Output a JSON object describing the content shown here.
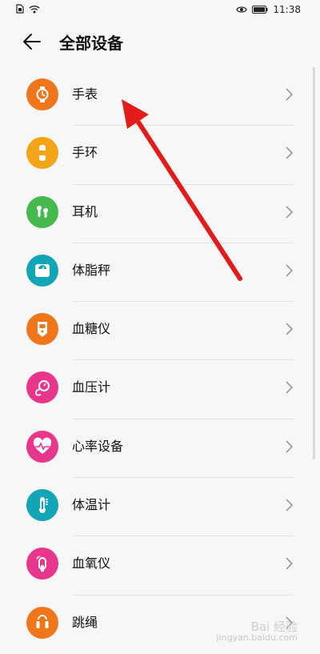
{
  "status_bar": {
    "time": "11:38",
    "left_icons": [
      "sim-icon",
      "wifi-icon"
    ],
    "right_icons": [
      "eye-icon",
      "battery-icon"
    ]
  },
  "header": {
    "title": "全部设备",
    "back_icon": "back-arrow-icon"
  },
  "devices": [
    {
      "label": "手表",
      "icon": "watch-icon",
      "color": "#f0761c"
    },
    {
      "label": "手环",
      "icon": "band-icon",
      "color": "#f5a416"
    },
    {
      "label": "耳机",
      "icon": "earphone-icon",
      "color": "#45b94e"
    },
    {
      "label": "体脂秤",
      "icon": "scale-icon",
      "color": "#12a5b5"
    },
    {
      "label": "血糖仪",
      "icon": "glucose-meter-icon",
      "color": "#f0761c"
    },
    {
      "label": "血压计",
      "icon": "blood-pressure-icon",
      "color": "#e8368c"
    },
    {
      "label": "心率设备",
      "icon": "heart-rate-icon",
      "color": "#e8368c"
    },
    {
      "label": "体温计",
      "icon": "thermometer-icon",
      "color": "#12a5b5"
    },
    {
      "label": "血氧仪",
      "icon": "oximeter-icon",
      "color": "#e8368c"
    },
    {
      "label": "跳绳",
      "icon": "jump-rope-icon",
      "color": "#f0761c"
    }
  ],
  "overlay": {
    "arrow_color": "#e31b1b"
  },
  "watermark": {
    "brand": "Bai 经验",
    "url": "jingyan.baidu.com"
  }
}
